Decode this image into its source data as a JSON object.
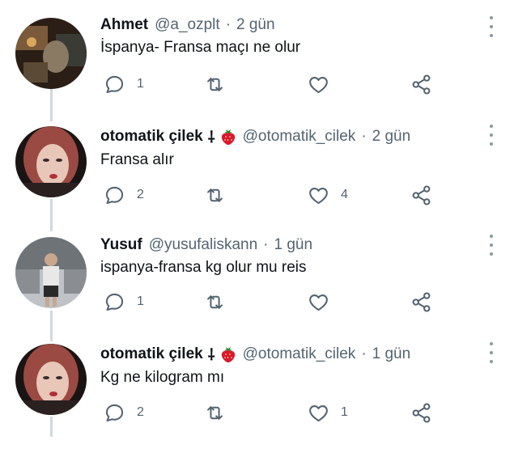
{
  "tweets": [
    {
      "name": "Ahmet",
      "badge": "",
      "strawberry": false,
      "handle": "@a_ozplt",
      "sep": "·",
      "time": "2 gün",
      "text": "İspanya- Fransa maçı ne olur",
      "replies": "1",
      "retweets": "",
      "likes": ""
    },
    {
      "name": "otomatik çilek",
      "badge": "⸸",
      "strawberry": true,
      "handle": "@otomatik_cilek",
      "sep": "·",
      "time": "2 gün",
      "text": "Fransa alır",
      "replies": "2",
      "retweets": "",
      "likes": "4"
    },
    {
      "name": "Yusuf",
      "badge": "",
      "strawberry": false,
      "handle": "@yusufaliskann",
      "sep": "·",
      "time": "1 gün",
      "text": "ispanya-fransa kg olur mu reis",
      "replies": "1",
      "retweets": "",
      "likes": ""
    },
    {
      "name": "otomatik çilek",
      "badge": "⸸",
      "strawberry": true,
      "handle": "@otomatik_cilek",
      "sep": "·",
      "time": "1 gün",
      "text": "Kg ne kilogram mı",
      "replies": "2",
      "retweets": "",
      "likes": "1"
    }
  ],
  "icons": {
    "reply": "reply-icon",
    "retweet": "retweet-icon",
    "like": "heart-icon",
    "share": "share-icon",
    "more": "more-icon"
  },
  "colors": {
    "text": "#0f1419",
    "secondary": "#536471",
    "thread": "#cfd9de",
    "strawberry": "#d9192e"
  }
}
